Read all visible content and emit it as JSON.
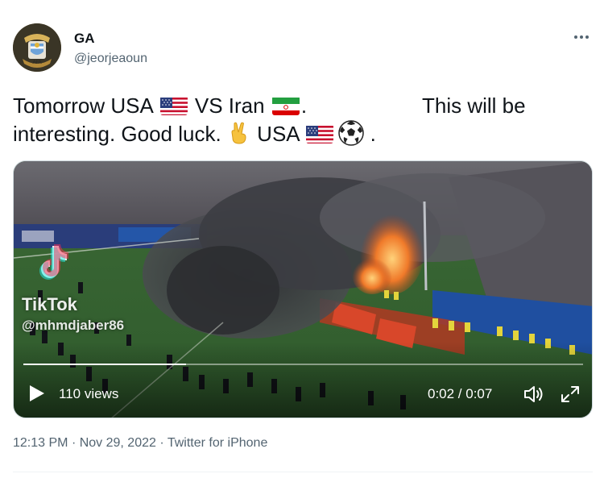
{
  "author": {
    "name": "GA",
    "handle": "@jeorjeaoun"
  },
  "tweet": {
    "line1_part1": "Tomorrow USA",
    "line1_part2": "VS  Iran",
    "line1_part3": ".",
    "line1_part4": "This will be",
    "line2_part1": "interesting. Good luck.",
    "line2_part2": "USA",
    "line2_part3": "."
  },
  "video": {
    "watermark_brand": "TikTok",
    "watermark_user": "@mhmdjaber86",
    "views": "110 views",
    "time": "0:02 / 0:07",
    "progress": 0.29
  },
  "meta": {
    "time": "12:13 PM",
    "sep1": "·",
    "date": "Nov 29, 2022",
    "sep2": "·",
    "source": "Twitter for iPhone"
  },
  "icons": {
    "more": "more-icon",
    "play": "play-icon",
    "volume": "volume-icon",
    "expand": "expand-icon"
  }
}
